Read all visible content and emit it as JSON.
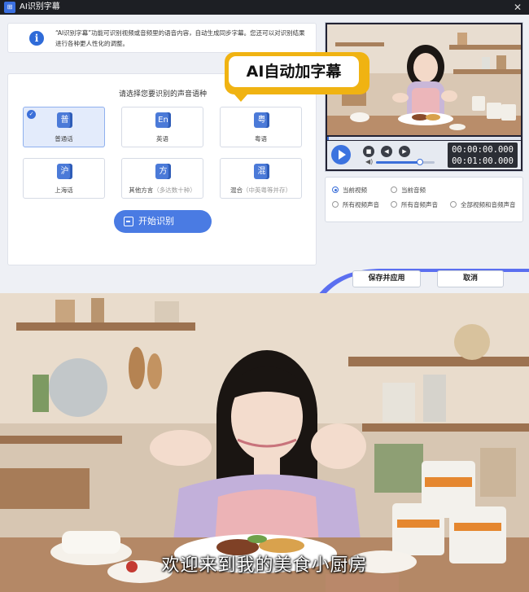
{
  "window": {
    "title": "AI识别字幕",
    "app_icon": "subtitle-app-icon",
    "close_glyph": "✕"
  },
  "info": {
    "icon": "info-icon",
    "text": "“AI识别字幕”功能可识别视频或音频里的语音内容，自动生成同步字幕。您还可以对识别结果进行各种更人性化的调整。"
  },
  "language": {
    "prompt": "请选择您要识别的声音语种",
    "selected_index": 0,
    "items": [
      {
        "glyph": "普",
        "label": "普通话",
        "hint": ""
      },
      {
        "glyph": "En",
        "label": "英语",
        "hint": ""
      },
      {
        "glyph": "粤",
        "label": "粤语",
        "hint": ""
      },
      {
        "glyph": "沪",
        "label": "上海话",
        "hint": ""
      },
      {
        "glyph": "方",
        "label": "其他方言",
        "hint": "（多达数十种）"
      },
      {
        "glyph": "混",
        "label": "混合",
        "hint": "（中英粤等并存）"
      }
    ]
  },
  "start_button": {
    "label": "开始识别",
    "icon": "recognize-icon"
  },
  "callout": {
    "text": "AI自动加字幕",
    "color": "#f0b312"
  },
  "player": {
    "progress": 0.01,
    "volume": 0.75,
    "time_current": "00:00:00.000",
    "time_total": "00:01:00.000",
    "buttons": [
      "play-icon",
      "stop-icon",
      "prev-icon",
      "next-icon",
      "volume-icon"
    ]
  },
  "source": {
    "options": [
      {
        "label": "当前视频",
        "checked": true
      },
      {
        "label": "当前音频",
        "checked": false
      },
      {
        "label": "所有视频声音",
        "checked": false
      },
      {
        "label": "所有音频声音",
        "checked": false
      },
      {
        "label": "全部视频和音频声音",
        "checked": false
      }
    ]
  },
  "actions": {
    "save_label": "保存并应用",
    "cancel_label": "取消"
  },
  "scene": {
    "subtitle": "欢迎来到我的美食小厨房"
  },
  "colors": {
    "accent": "#3b6fd9",
    "titlebar": "#1d1f24",
    "dialog_bg": "#eef0f5"
  }
}
